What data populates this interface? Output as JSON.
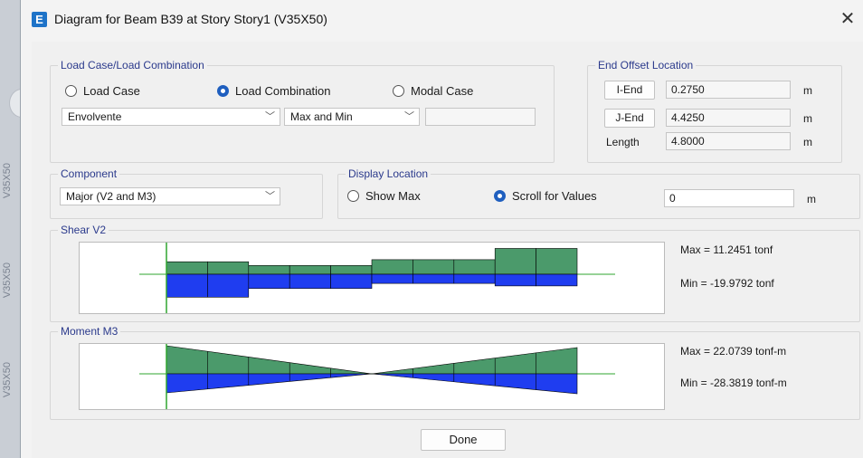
{
  "window": {
    "title": "Diagram for Beam B39 at Story Story1 (V35X50)",
    "app_icon": "E",
    "close": "✕"
  },
  "background": {
    "side_labels": [
      "V35X50",
      "V35X50",
      "V35X50"
    ]
  },
  "load_case": {
    "group_label": "Load Case/Load Combination",
    "options": [
      "Load Case",
      "Load Combination",
      "Modal Case"
    ],
    "selected": "Load Combination",
    "combo_value": "Envolvente",
    "type_value": "Max and Min",
    "extra_value": ""
  },
  "end_offset": {
    "group_label": "End Offset Location",
    "i_end_label": "I-End",
    "i_end_value": "0.2750",
    "j_end_label": "J-End",
    "j_end_value": "4.4250",
    "length_label": "Length",
    "length_value": "4.8000",
    "unit": "m"
  },
  "component": {
    "group_label": "Component",
    "value": "Major (V2 and M3)"
  },
  "display_location": {
    "group_label": "Display Location",
    "options": [
      "Show Max",
      "Scroll for Values"
    ],
    "selected": "Scroll for Values",
    "value": "0",
    "unit": "m"
  },
  "shear": {
    "group_label": "Shear V2",
    "max_text": "Max = 11.2451 tonf",
    "min_text": "Min = -19.9792 tonf",
    "positive": [
      3.0,
      3.0,
      2.1,
      2.1,
      2.1,
      3.5,
      3.5,
      3.5,
      6.2,
      6.2
    ],
    "negative": [
      5.5,
      5.5,
      3.4,
      3.4,
      3.4,
      2.2,
      2.2,
      2.2,
      2.8,
      2.8
    ]
  },
  "moment": {
    "group_label": "Moment M3",
    "max_text": "Max = 22.0739 tonf-m",
    "min_text": "Min = -28.3819 tonf-m"
  },
  "colors": {
    "positive": "#4b9a6b",
    "negative": "#1f3df0",
    "axis": "#2fa52f"
  },
  "done_label": "Done"
}
